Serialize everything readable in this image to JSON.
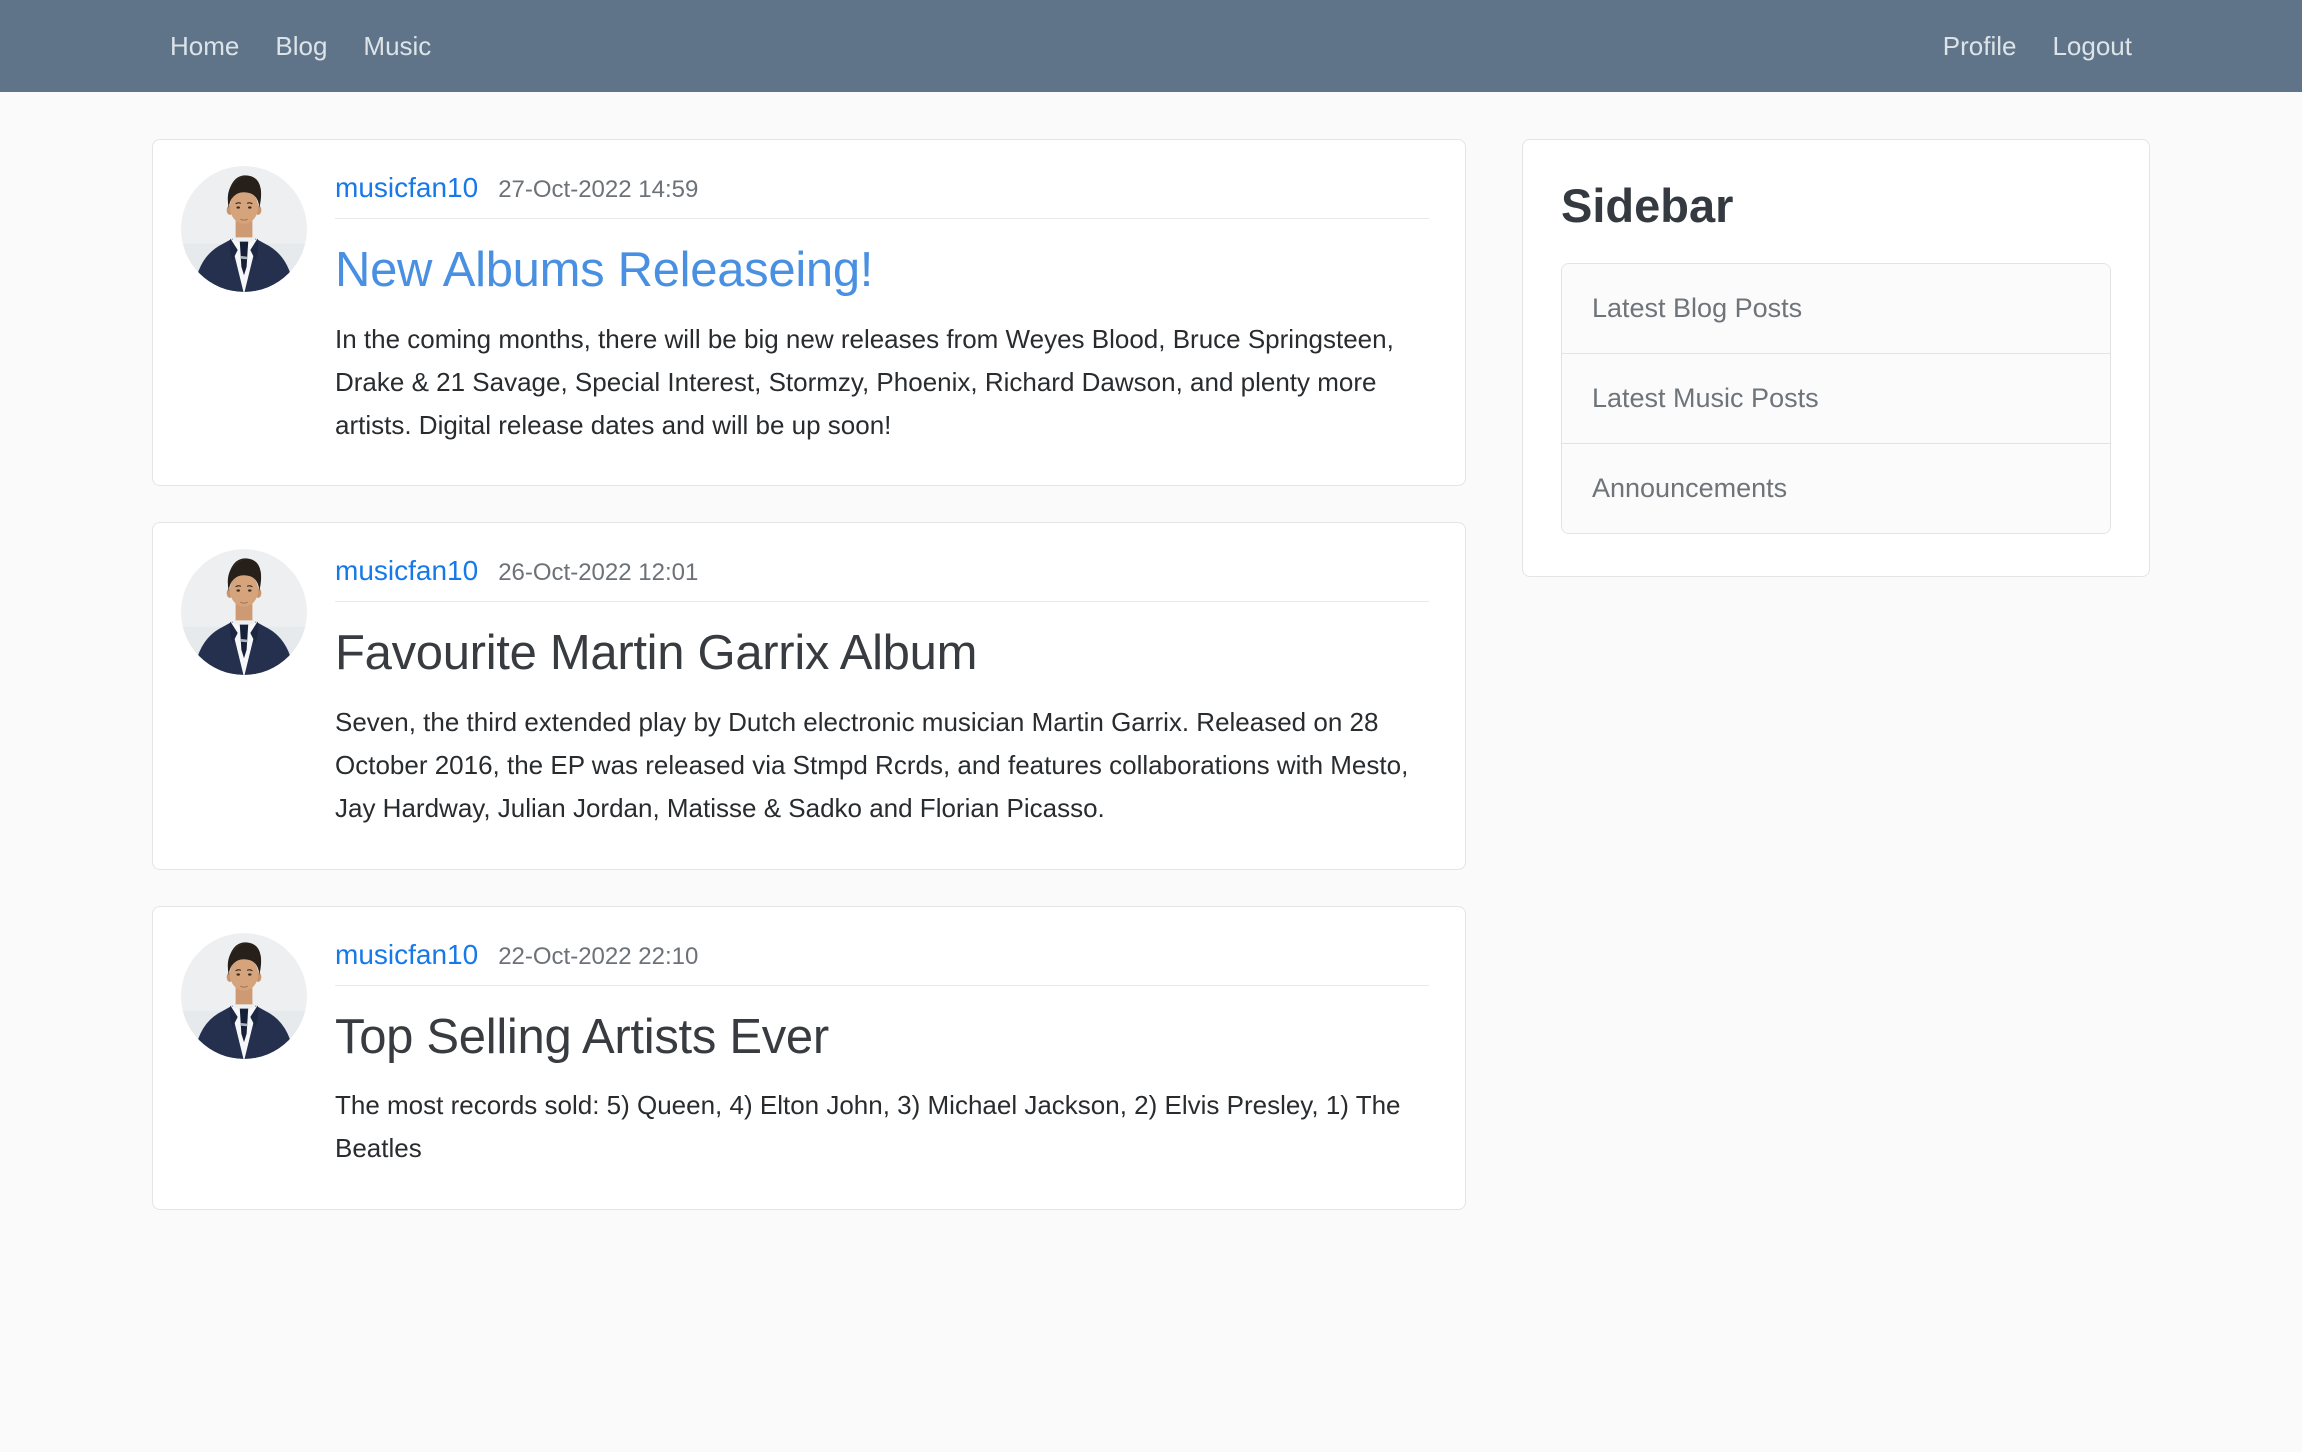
{
  "nav": {
    "left": [
      {
        "label": "Home"
      },
      {
        "label": "Blog"
      },
      {
        "label": "Music"
      }
    ],
    "right": [
      {
        "label": "Profile"
      },
      {
        "label": "Logout"
      }
    ]
  },
  "posts": [
    {
      "username": "musicfan10",
      "timestamp": "27-Oct-2022 14:59",
      "title": "New Albums Releaseing!",
      "body": "In the coming months, there will be big new releases from Weyes Blood, Bruce Springsteen, Drake & 21 Savage, Special Interest, Stormzy, Phoenix, Richard Dawson, and plenty more artists. Digital release dates and will be up soon!"
    },
    {
      "username": "musicfan10",
      "timestamp": "26-Oct-2022 12:01",
      "title": "Favourite Martin Garrix Album",
      "body": "Seven, the third extended play by Dutch electronic musician Martin Garrix. Released on 28 October 2016, the EP was released via Stmpd Rcrds, and features collaborations with Mesto, Jay Hardway, Julian Jordan, Matisse & Sadko and Florian Picasso."
    },
    {
      "username": "musicfan10",
      "timestamp": "22-Oct-2022 22:10",
      "title": "Top Selling Artists Ever",
      "body": "The most records sold: 5) Queen, 4) Elton John, 3) Michael Jackson, 2) Elvis Presley, 1) The Beatles"
    }
  ],
  "sidebar": {
    "title": "Sidebar",
    "items": [
      {
        "label": "Latest Blog Posts"
      },
      {
        "label": "Latest Music Posts"
      },
      {
        "label": "Announcements"
      }
    ]
  },
  "icons": {
    "avatar": "user-portrait-photo"
  },
  "theme": {
    "navbar_bg": "#5f7488",
    "nav_link": "#dde4e9",
    "username_link": "#1778e9",
    "post1_title_blue": "#4a90e2",
    "title_dark": "#383c40",
    "page_bg": "#fafafa",
    "card_bg": "#ffffff",
    "muted_text": "#6d7278"
  }
}
